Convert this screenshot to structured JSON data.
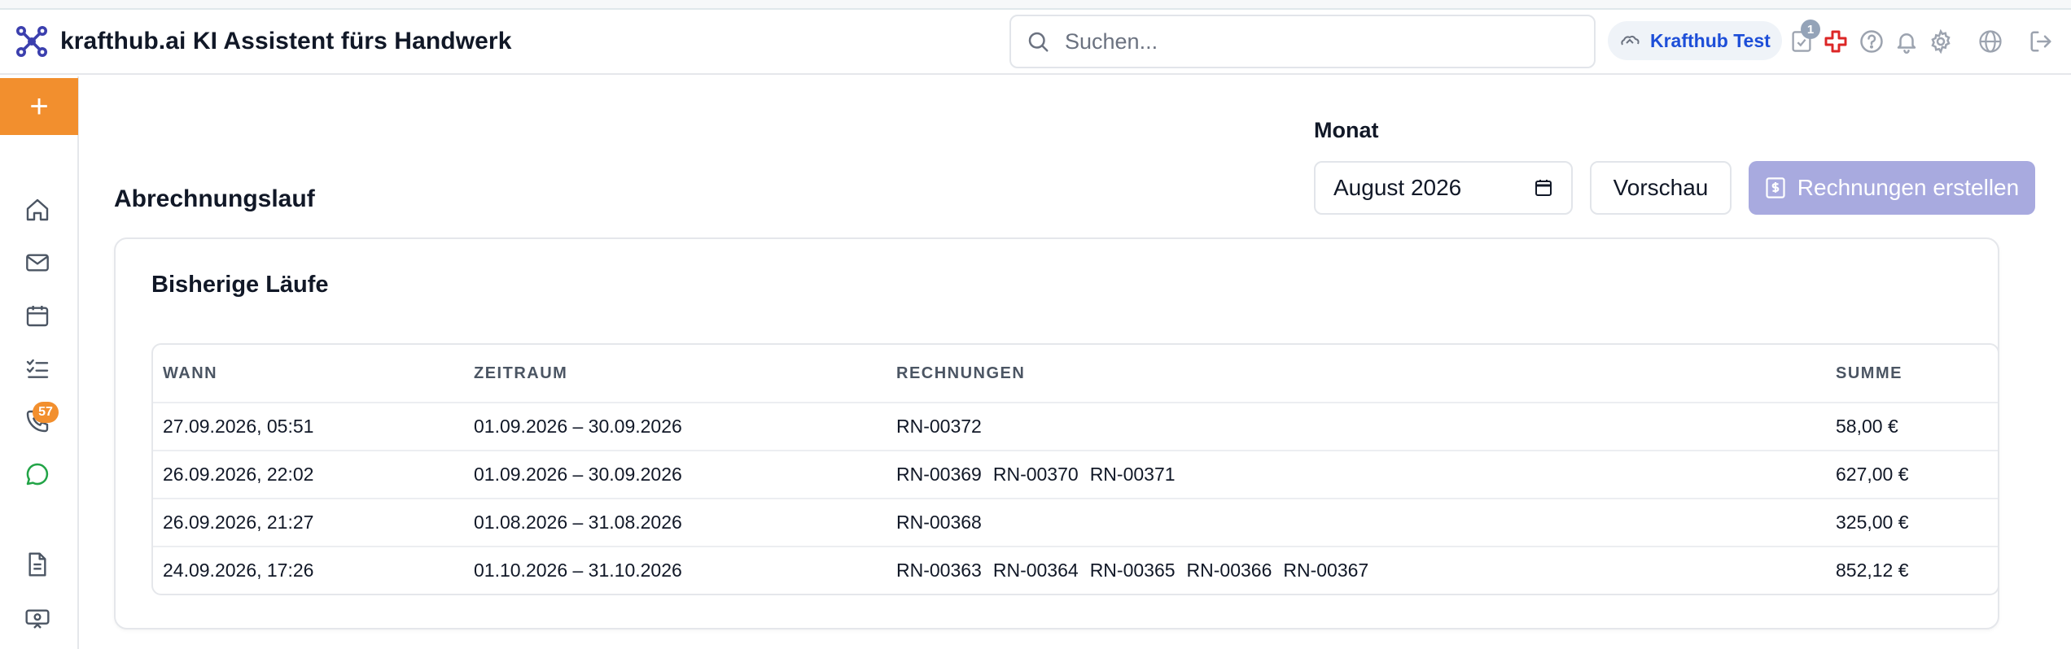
{
  "app": {
    "title": "krafthub.ai KI Assistent fürs Handwerk"
  },
  "search": {
    "placeholder": "Suchen..."
  },
  "header": {
    "tenant": "Krafthub Test",
    "notification_badge": "1",
    "icons": [
      "document-check-icon",
      "medical-cross-icon",
      "help-icon",
      "bell-icon",
      "gear-icon",
      "globe-icon",
      "logout-icon"
    ]
  },
  "sidebar": {
    "add_label": "+",
    "items": [
      "home-icon",
      "mail-icon",
      "calendar-icon",
      "checklist-icon",
      "phone-icon",
      "chat-icon",
      "document-icon",
      "device-icon"
    ],
    "phone_badge": "57"
  },
  "page": {
    "title": "Abrechnungslauf",
    "month_label": "Monat",
    "month_value": "August 2026",
    "preview_label": "Vorschau",
    "create_label": "Rechnungen erstellen"
  },
  "runs": {
    "title": "Bisherige Läufe",
    "columns": [
      "WANN",
      "ZEITRAUM",
      "RECHNUNGEN",
      "SUMME"
    ],
    "rows": [
      {
        "when": "27.09.2026, 05:51",
        "period": "01.09.2026 – 30.09.2026",
        "invoices": [
          "RN-00372"
        ],
        "sum": "58,00 €"
      },
      {
        "when": "26.09.2026, 22:02",
        "period": "01.09.2026 – 30.09.2026",
        "invoices": [
          "RN-00369",
          "RN-00370",
          "RN-00371"
        ],
        "sum": "627,00 €"
      },
      {
        "when": "26.09.2026, 21:27",
        "period": "01.08.2026 – 31.08.2026",
        "invoices": [
          "RN-00368"
        ],
        "sum": "325,00 €"
      },
      {
        "when": "24.09.2026, 17:26",
        "period": "01.10.2026 – 31.10.2026",
        "invoices": [
          "RN-00363",
          "RN-00364",
          "RN-00365",
          "RN-00366",
          "RN-00367"
        ],
        "sum": "852,12 €"
      }
    ]
  },
  "colors": {
    "accent": "#f28f2e",
    "brand": "#3b3fae",
    "primary_disabled": "#a8aadf",
    "tenant_text": "#1d4ed8",
    "chat_green": "#22a447"
  }
}
